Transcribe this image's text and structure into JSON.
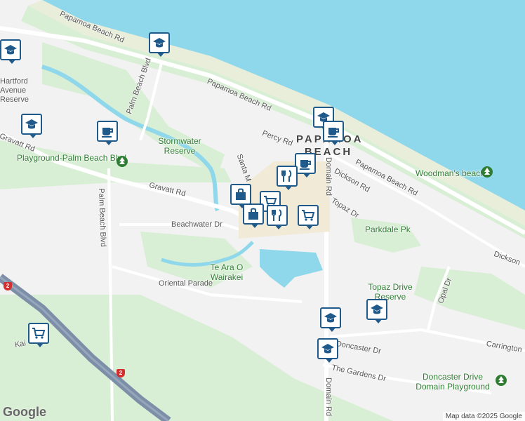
{
  "map": {
    "attribution": "Map data ©2025 Google",
    "logo": "Google",
    "colors": {
      "water": "#8fd7ea",
      "land": "#f2f2f2",
      "park": "#d9efd5",
      "road": "#ffffff",
      "motorway": "#7c8fa7",
      "pin_border": "#1f5a8a",
      "park_icon": "#2e7d32"
    }
  },
  "labels": {
    "papamoa_beach_rd_top": "Papamoa Beach Rd",
    "papamoa_beach_rd_mid": "Papamoa Beach Rd",
    "papamoa_beach_rd_right": "Papamoa Beach Rd",
    "palm_beach_blvd_top": "Palm Beach Blvd",
    "palm_beach_blvd_bottom": "Palm Beach Blvd",
    "gravatt_rd_left": "Gravatt Rd",
    "gravatt_rd_mid": "Gravatt Rd",
    "stormwater_reserve": "Stormwater Reserve",
    "playground": "Playground-Palm Beach Blvd",
    "percy_rd": "Percy Rd",
    "santa_m": "Santa M",
    "papamoa_town": "PAPAMOA BEACH",
    "domain_rd_top": "Domain Rd",
    "domain_rd_bottom": "Domain Rd",
    "dickson_rd_top": "Dickson Rd",
    "dickson_rd_right": "Dickson",
    "topaz_dr": "Topaz Dr",
    "woodmans_beach": "Woodman's beach",
    "parkdale_pk": "Parkdale Pk",
    "beachwater_dr": "Beachwater Dr",
    "te_ara_o_wairakei": "Te Ara O Wairakei",
    "oriental_parade": "Oriental Parade",
    "topaz_drive_reserve": "Topaz Drive Reserve",
    "opal_dr": "Opal Dr",
    "carrington": "Carrington",
    "doncaster_dr": "Doncaster Dr",
    "the_gardens_dr": "The Gardens Dr",
    "doncaster_playground": "Doncaster Drive Domain Playground",
    "kai": "Kai",
    "hartford_avenue_reserve": "Hartford Avenue Reserve",
    "route_2": "2"
  },
  "pins": [
    {
      "type": "school",
      "icon": "school-icon"
    },
    {
      "type": "school",
      "icon": "school-icon"
    },
    {
      "type": "school",
      "icon": "school-icon"
    },
    {
      "type": "cafe",
      "icon": "coffee-cup-icon"
    },
    {
      "type": "school",
      "icon": "school-icon"
    },
    {
      "type": "cafe",
      "icon": "coffee-cup-icon"
    },
    {
      "type": "cafe",
      "icon": "coffee-cup-icon"
    },
    {
      "type": "restaurant",
      "icon": "restaurant-icon"
    },
    {
      "type": "shopping",
      "icon": "shopping-bag-icon"
    },
    {
      "type": "supermarket",
      "icon": "shopping-cart-icon"
    },
    {
      "type": "shopping",
      "icon": "shopping-bag-icon"
    },
    {
      "type": "restaurant",
      "icon": "restaurant-icon"
    },
    {
      "type": "supermarket",
      "icon": "shopping-cart-icon"
    },
    {
      "type": "school",
      "icon": "school-icon"
    },
    {
      "type": "school",
      "icon": "school-icon"
    },
    {
      "type": "school",
      "icon": "school-icon"
    },
    {
      "type": "supermarket",
      "icon": "shopping-cart-icon"
    }
  ]
}
